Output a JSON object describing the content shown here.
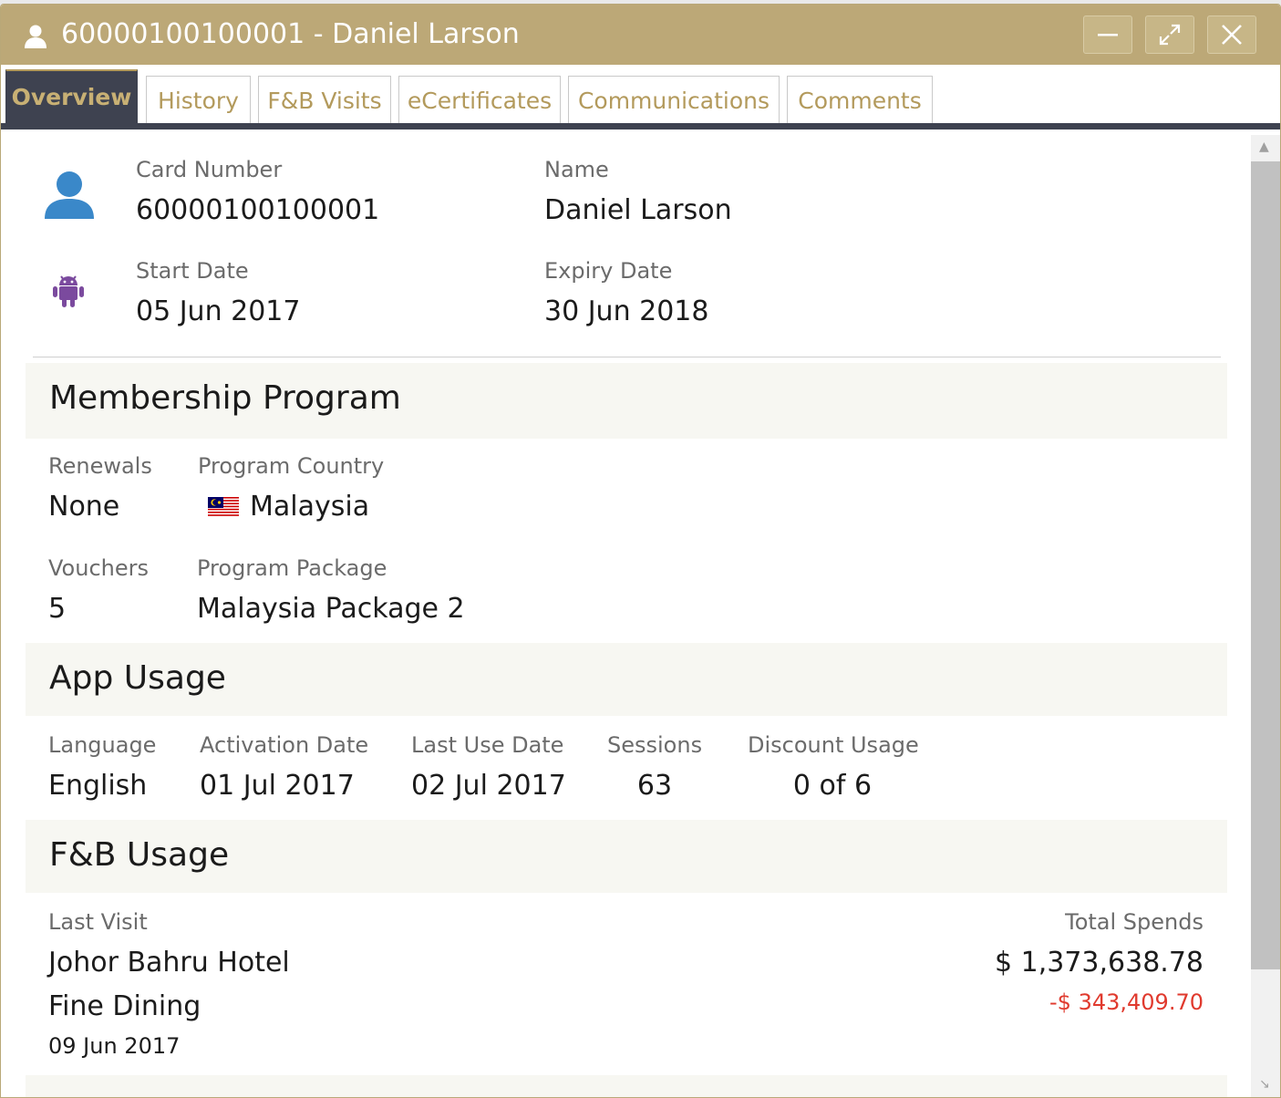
{
  "window": {
    "title": "60000100100001 - Daniel Larson",
    "colors": {
      "titlebar": "#bca877",
      "tab_active_bg": "#3e4250",
      "accent": "#b39a5c"
    }
  },
  "tabs": [
    {
      "label": "Overview",
      "active": true
    },
    {
      "label": "History"
    },
    {
      "label": "F&B Visits"
    },
    {
      "label": "eCertificates"
    },
    {
      "label": "Communications"
    },
    {
      "label": "Comments"
    }
  ],
  "card": {
    "card_number_label": "Card Number",
    "card_number": "60000100100001",
    "name_label": "Name",
    "name": "Daniel Larson",
    "start_date_label": "Start Date",
    "start_date": "05 Jun 2017",
    "expiry_date_label": "Expiry Date",
    "expiry_date": "30 Jun 2018",
    "icons": [
      "user-icon",
      "android-icon"
    ]
  },
  "membership": {
    "title": "Membership Program",
    "renewals_label": "Renewals",
    "renewals": "None",
    "country_label": "Program Country",
    "country": "Malaysia",
    "country_flag_icon": "malaysia-flag-icon",
    "vouchers_label": "Vouchers",
    "vouchers": "5",
    "package_label": "Program Package",
    "package": "Malaysia Package 2"
  },
  "app_usage": {
    "title": "App Usage",
    "language_label": "Language",
    "language": "English",
    "activation_label": "Activation Date",
    "activation": "01 Jul 2017",
    "last_use_label": "Last Use Date",
    "last_use": "02 Jul 2017",
    "sessions_label": "Sessions",
    "sessions": "63",
    "discount_label": "Discount Usage",
    "discount": "0 of 6"
  },
  "fb_usage": {
    "title": "F&B Usage",
    "last_visit_label": "Last Visit",
    "hotel": "Johor Bahru Hotel",
    "outlet": "Fine Dining",
    "visit_date": "09 Jun 2017",
    "total_spends_label": "Total Spends",
    "total_spends": "$ 1,373,638.78",
    "discount_amount": "-$ 343,409.70"
  }
}
